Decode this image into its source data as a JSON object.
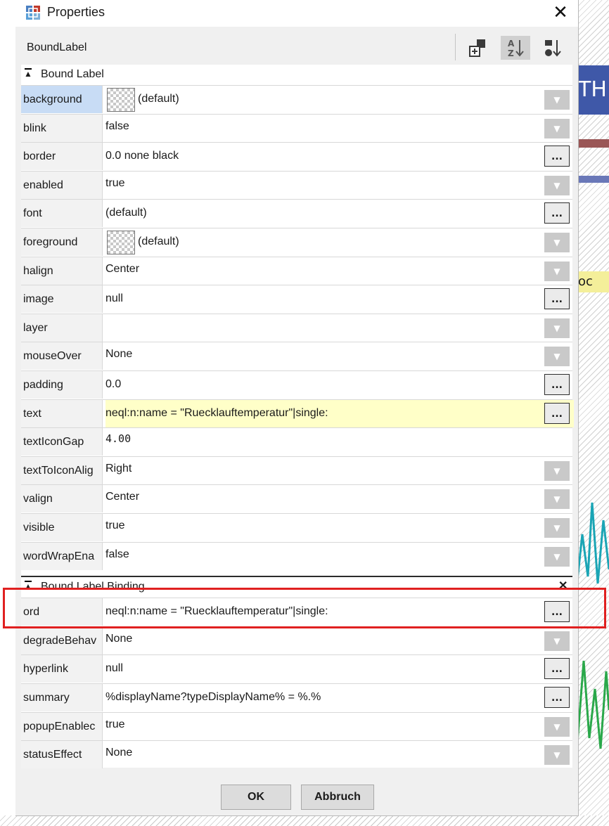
{
  "window": {
    "title": "Properties",
    "close_symbol": "✕"
  },
  "toolbar": {
    "component_name": "BoundLabel"
  },
  "background_app": {
    "header_text": "TH",
    "snippet_text": "oc"
  },
  "sections": [
    {
      "title": "Bound Label",
      "rows": [
        {
          "name": "background",
          "value": "(default)",
          "control": "dropdown",
          "swatch": true,
          "selected": true
        },
        {
          "name": "blink",
          "value": "false",
          "control": "dropdown"
        },
        {
          "name": "border",
          "value": "0.0 none black",
          "control": "more"
        },
        {
          "name": "enabled",
          "value": "true",
          "control": "dropdown"
        },
        {
          "name": "font",
          "value": "(default)",
          "control": "more"
        },
        {
          "name": "foreground",
          "value": "(default)",
          "control": "dropdown",
          "swatch": true
        },
        {
          "name": "halign",
          "value": "Center",
          "control": "dropdown"
        },
        {
          "name": "image",
          "value": "null",
          "control": "more"
        },
        {
          "name": "layer",
          "value": "",
          "control": "dropdown"
        },
        {
          "name": "mouseOver",
          "value": "None",
          "control": "dropdown"
        },
        {
          "name": "padding",
          "value": "0.0",
          "control": "more"
        },
        {
          "name": "text",
          "value": "neql:n:name = \"Ruecklauftemperatur\"|single:",
          "control": "more",
          "highlighted": true
        },
        {
          "name": "textIconGap",
          "value": "4.00",
          "control": "none",
          "mono": true
        },
        {
          "name": "textToIconAlig",
          "value": "Right",
          "control": "dropdown"
        },
        {
          "name": "valign",
          "value": "Center",
          "control": "dropdown"
        },
        {
          "name": "visible",
          "value": "true",
          "control": "dropdown"
        },
        {
          "name": "wordWrapEna",
          "value": "false",
          "control": "dropdown"
        }
      ]
    },
    {
      "title": "Bound Label Binding",
      "close_symbol": "✕",
      "rows": [
        {
          "name": "ord",
          "value": "neql:n:name = \"Ruecklauftemperatur\"|single:",
          "control": "more"
        },
        {
          "name": "degradeBehav",
          "value": "None",
          "control": "dropdown"
        },
        {
          "name": "hyperlink",
          "value": "null",
          "control": "more"
        },
        {
          "name": "summary",
          "value": "%displayName?typeDisplayName% = %.%",
          "control": "more"
        },
        {
          "name": "popupEnablec",
          "value": "true",
          "control": "dropdown"
        },
        {
          "name": "statusEffect",
          "value": "None",
          "control": "dropdown"
        }
      ]
    }
  ],
  "controls": {
    "more_label": "...",
    "dropdown_symbol": "▼"
  },
  "footer": {
    "ok_label": "OK",
    "cancel_label": "Abbruch"
  },
  "colors": {
    "selected_row": "#c8dcf5",
    "highlight_row": "#ffffc8",
    "annotation_box": "#e02020"
  }
}
